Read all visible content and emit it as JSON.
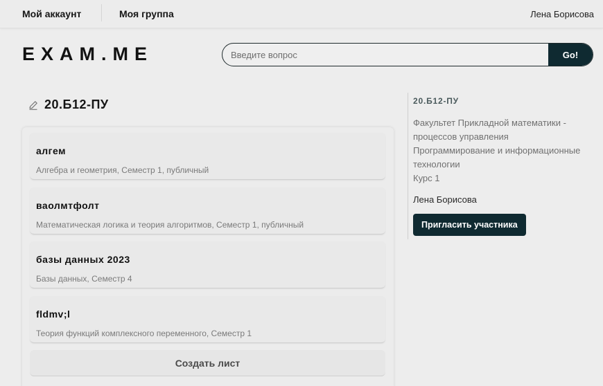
{
  "topbar": {
    "my_account": "Мой аккаунт",
    "my_group": "Моя группа",
    "user_name": "Лена Борисова"
  },
  "logo": "EXAM.ME",
  "search": {
    "placeholder": "Введите вопрос",
    "value": "",
    "button_label": "Go!"
  },
  "group": {
    "title": "20.Б12-ПУ",
    "edit_icon": "pencil-icon"
  },
  "lists": [
    {
      "title": "алгем",
      "description": "Алгебра и геометрия, Семестр 1, публичный"
    },
    {
      "title": "ваолмтфолт",
      "description": "Математическая логика и теория алгоритмов, Семестр 1, публичный"
    },
    {
      "title": "базы данных 2023",
      "description": "Базы данных, Семестр 4"
    },
    {
      "title": "fldmv;l",
      "description": "Теория функций комплексного переменного, Семестр 1"
    }
  ],
  "create_button_label": "Создать лист",
  "side": {
    "group_title": "20.Б12-ПУ",
    "faculty": "Факультет Прикладной математики - процессов управления",
    "program": "Программирование и информационные технологии",
    "course": "Курс 1",
    "owner": "Лена Борисова",
    "invite_label": "Пригласить участника"
  },
  "colors": {
    "accent": "#0f2a31",
    "background": "#ededed"
  }
}
